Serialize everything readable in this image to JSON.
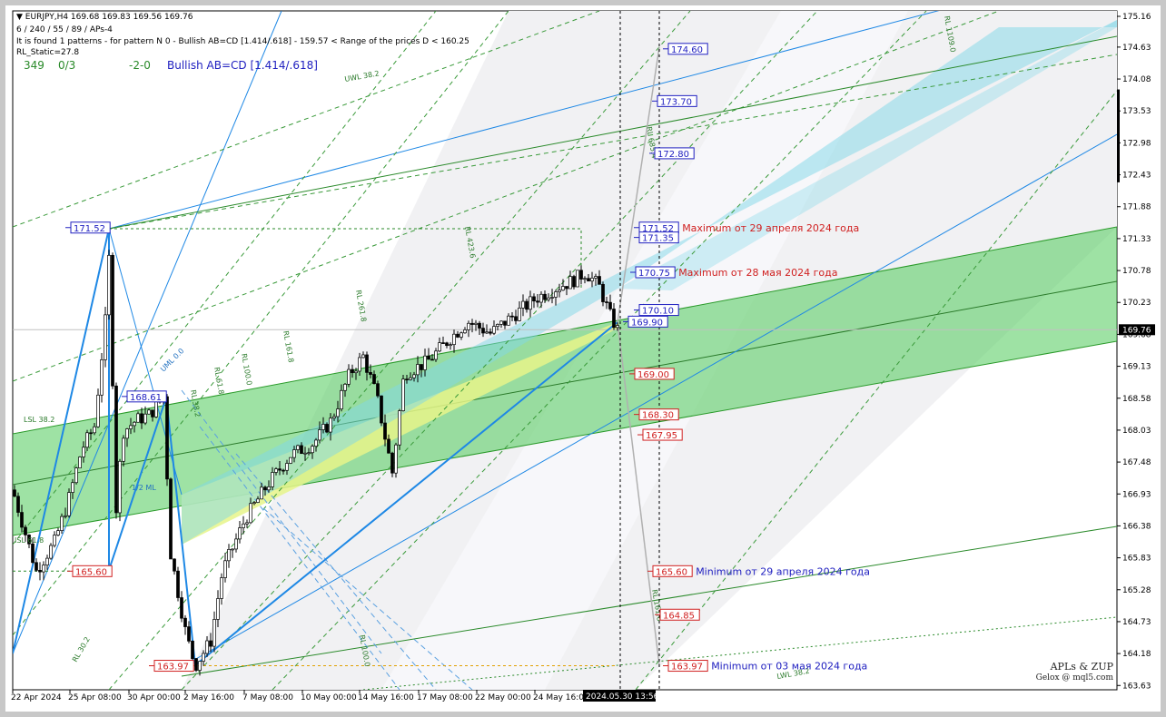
{
  "header": {
    "symbol_line": "EURJPY,H4  169.68 169.83 169.56 169.76",
    "params_line": "6 / 240 / 55 / 89 / APs-4",
    "pattern_line": "It is found 1 patterns  -  for pattern N 0 - Bullish AB=CD [1.414/.618] - 159.57 < Range of the prices D < 160.25",
    "static_line": "RL_Static=27.8",
    "counter": "349",
    "ratio": "0/3",
    "wave_label": "-2-0",
    "pattern_name": "Bullish AB=CD [1.414/.618]"
  },
  "signature": {
    "line1": "APLs & ZUP",
    "line2": "Gelox @ mql5.com"
  },
  "colors": {
    "bull_candle": "#000000",
    "price_box": "#2020c0",
    "sell_box": "#d02020",
    "green_channel": "#4fca59",
    "cyan_channel": "#7fd8e8",
    "yellow_zone": "#e6f58a",
    "zigzag": "#1e88e5",
    "grid_text": "#000000"
  },
  "chart_data": {
    "type": "candlestick",
    "symbol": "EURJPY",
    "timeframe": "H4",
    "ylim": [
      163.65,
      175.16
    ],
    "current_price": 169.76,
    "y_ticks": [
      175.16,
      174.63,
      174.08,
      173.53,
      172.98,
      172.43,
      171.88,
      171.33,
      170.78,
      170.23,
      169.68,
      169.13,
      168.58,
      168.03,
      167.48,
      166.93,
      166.38,
      165.83,
      165.28,
      164.73,
      164.18,
      163.63
    ],
    "x_ticks": [
      "22 Apr 2024",
      "25 Apr 08:00",
      "30 Apr 00:00",
      "2 May 16:00",
      "7 May 08:00",
      "10 May 00:00",
      "14 May 16:00",
      "17 May 08:00",
      "22 May 00:00",
      "24 May 16:00"
    ],
    "cursor_time": "2024.05.30 13:56",
    "price_boxes_blue": [
      {
        "value": 171.52,
        "label": "171.52"
      },
      {
        "value": 168.61,
        "label": "168.61"
      },
      {
        "value": 174.6,
        "label": "174.60"
      },
      {
        "value": 173.7,
        "label": "173.70"
      },
      {
        "value": 172.8,
        "label": "172.80"
      },
      {
        "value": 171.52,
        "label": "171.52",
        "note": "Maximum от 29 апреля 2024 года"
      },
      {
        "value": 171.35,
        "label": "171.35"
      },
      {
        "value": 170.75,
        "label": "170.75",
        "note": "Maximum от 28 мая 2024 года"
      },
      {
        "value": 170.1,
        "label": "170.10"
      },
      {
        "value": 169.9,
        "label": "169.90"
      }
    ],
    "price_boxes_red": [
      {
        "value": 165.6,
        "label": "165.60"
      },
      {
        "value": 163.97,
        "label": "163.97"
      },
      {
        "value": 169.0,
        "label": "169.00"
      },
      {
        "value": 168.3,
        "label": "168.30"
      },
      {
        "value": 167.95,
        "label": "167.95"
      },
      {
        "value": 165.6,
        "label": "165.60",
        "note": "Minimum от 29 апреля 2024 года"
      },
      {
        "value": 164.85,
        "label": "164.85"
      },
      {
        "value": 163.97,
        "label": "163.97",
        "note": "Minimum от 03 мая 2024 года"
      }
    ],
    "line_labels": [
      "UWL 38.2",
      "RL 423.6",
      "RL 261.8",
      "RL 161.8",
      "RL 100.0",
      "RL 61.8",
      "RL 38.2",
      "UML 0.0",
      "1/2 ML",
      "LSL 38.2",
      "ISL 61.8",
      "RL 100.0",
      "RL 685.4",
      "RL 1109.0",
      "RL 161.8",
      "LWL 38.2",
      "RL 30.2"
    ]
  }
}
